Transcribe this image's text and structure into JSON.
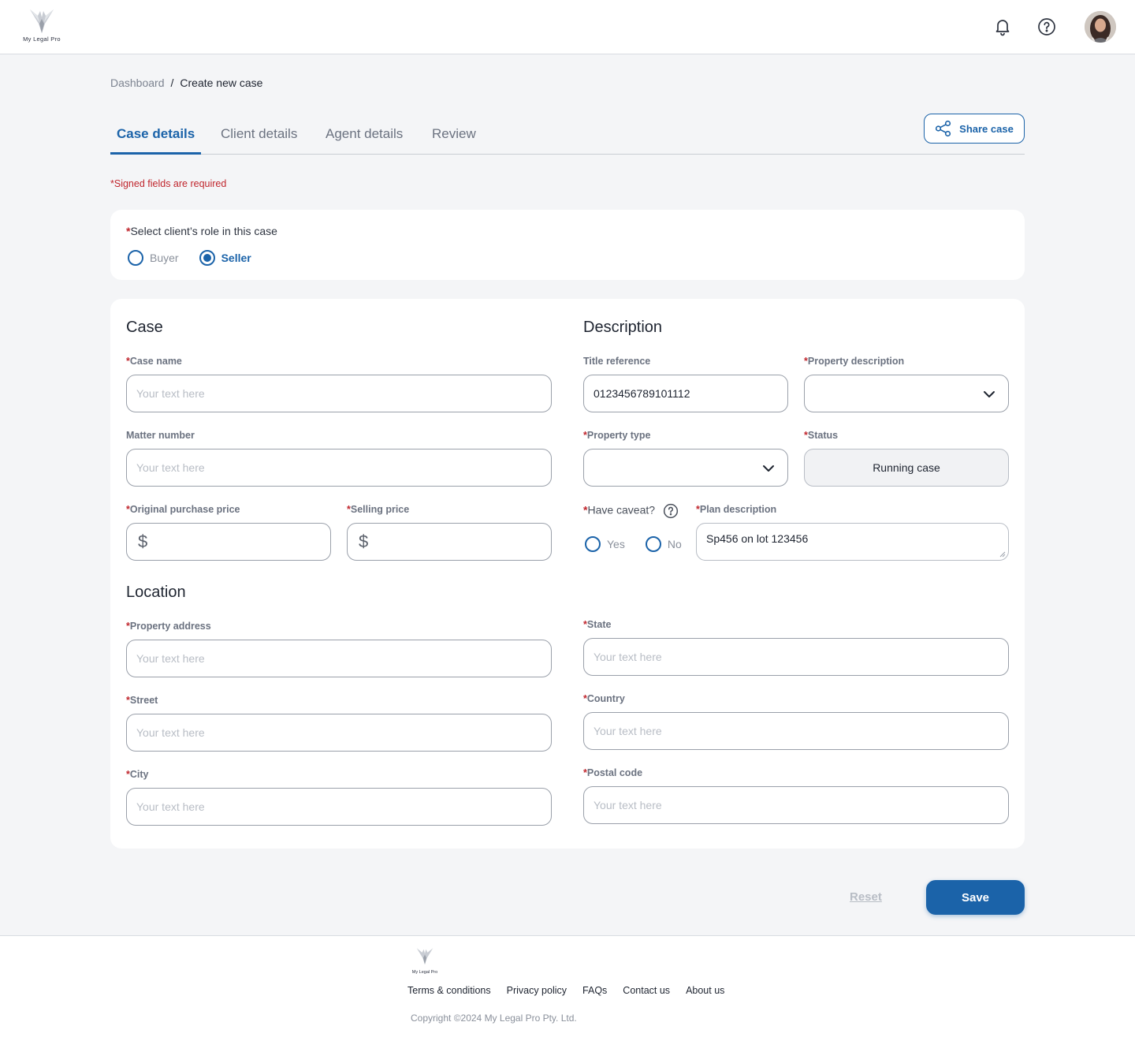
{
  "brand": {
    "name": "My Legal Pro"
  },
  "header": {
    "icons": [
      "bell-icon",
      "help-circle-icon"
    ],
    "avatar_alt": "user-avatar"
  },
  "breadcrumb": {
    "parent": "Dashboard",
    "separator": "/",
    "current": "Create new case"
  },
  "tabs": [
    "Case details",
    "Client details",
    "Agent details",
    "Review"
  ],
  "active_tab": "Case details",
  "share_button": {
    "label": "Share case",
    "icon": "share-icon"
  },
  "required_note": "*Signed fields are required",
  "role": {
    "label": "Select client’s role in this case",
    "options": [
      "Buyer",
      "Seller"
    ],
    "selected": "Seller"
  },
  "case": {
    "title": "Case",
    "case_name": {
      "label": "Case name",
      "placeholder": "Your text here"
    },
    "matter_number": {
      "label": "Matter number",
      "placeholder": "Your text here"
    },
    "original_price": {
      "label": "Original purchase price",
      "currency": "$"
    },
    "selling_price": {
      "label": "Selling price",
      "currency": "$"
    }
  },
  "description": {
    "title": "Description",
    "title_reference": {
      "label": "Title reference",
      "value": "0123456789101112"
    },
    "property_description": {
      "label": "Property description",
      "value": ""
    },
    "property_type": {
      "label": "Property type",
      "value": ""
    },
    "status": {
      "label": "Status",
      "value": "Running case"
    },
    "caveat": {
      "label": "Have caveat?",
      "options": [
        "Yes",
        "No"
      ],
      "selected": ""
    },
    "plan_description": {
      "label": "Plan description",
      "value": "Sp456 on lot 123456"
    }
  },
  "location": {
    "title": "Location",
    "property_address": {
      "label": "Property address",
      "placeholder": "Your text here"
    },
    "street": {
      "label": "Street",
      "placeholder": "Your text here"
    },
    "city": {
      "label": "City",
      "placeholder": "Your text here"
    },
    "state": {
      "label": "State",
      "placeholder": "Your text here"
    },
    "country": {
      "label": "Country",
      "placeholder": "Your text here"
    },
    "postal_code": {
      "label": "Postal code",
      "placeholder": "Your text here"
    }
  },
  "actions": {
    "reset": "Reset",
    "save": "Save"
  },
  "footer": {
    "links": [
      "Terms & conditions",
      "Privacy policy",
      "FAQs",
      "Contact us",
      "About us"
    ],
    "copyright": "Copyright ©2024 My Legal Pro Pty. Ltd."
  },
  "colors": {
    "accent": "#1b63a9",
    "required": "#c0262d",
    "background": "#f4f5f7"
  }
}
